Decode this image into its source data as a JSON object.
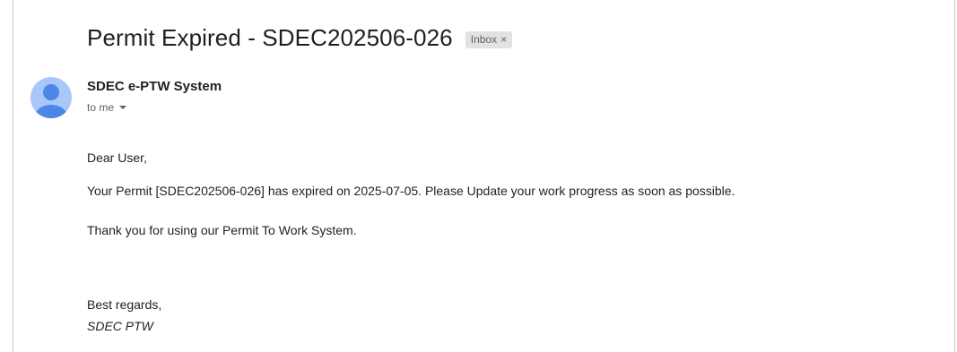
{
  "email": {
    "subject": "Permit Expired - SDEC202506-026",
    "label": "Inbox",
    "label_remove_glyph": "×",
    "sender": {
      "name": "SDEC e-PTW System",
      "recipient_text": "to me",
      "avatar_icon": "person-icon",
      "avatar_color": "#a8c7fa",
      "avatar_figure_color": "#4b87e8"
    },
    "body": {
      "greeting": "Dear User,",
      "message": "Your Permit [SDEC202506-026] has expired on 2025-07-05. Please Update your work progress as soon as possible.",
      "thanks": "Thank you for using our Permit To Work System.",
      "closing": "Best regards,",
      "signature": "SDEC PTW"
    }
  }
}
